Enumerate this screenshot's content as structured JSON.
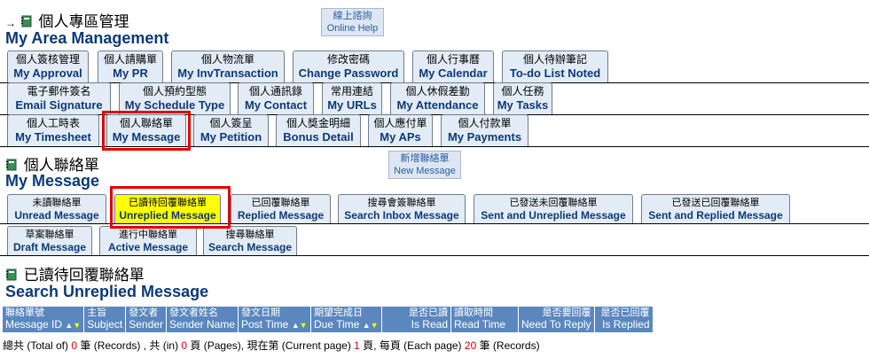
{
  "section1": {
    "arrow": "→",
    "title_zh": "個人專區管理",
    "title_en": "My Area Management",
    "help_zh": "線上諮詢",
    "help_en": "Online Help"
  },
  "area_tabs": [
    [
      {
        "zh": "個人簽核管理",
        "en": "My Approval"
      },
      {
        "zh": "個人請購單",
        "en": "My PR"
      },
      {
        "zh": "個人物流單",
        "en": "My InvTransaction"
      },
      {
        "zh": "修改密碼",
        "en": "Change Password"
      },
      {
        "zh": "個人行事曆",
        "en": "My Calendar"
      },
      {
        "zh": "個人待辦筆記",
        "en": "To-do List Noted"
      }
    ],
    [
      {
        "zh": "電子郵件簽名",
        "en": "Email Signature"
      },
      {
        "zh": "個人預約型態",
        "en": "My Schedule Type"
      },
      {
        "zh": "個人通訊錄",
        "en": "My Contact"
      },
      {
        "zh": "常用連結",
        "en": "My URLs"
      },
      {
        "zh": "個人休假差勤",
        "en": "My Attendance"
      },
      {
        "zh": "個人任務",
        "en": "My Tasks"
      }
    ],
    [
      {
        "zh": "個人工時表",
        "en": "My Timesheet"
      },
      {
        "zh": "個人聯絡單",
        "en": "My Message"
      },
      {
        "zh": "個人簽呈",
        "en": "My Petition"
      },
      {
        "zh": "個人獎金明細",
        "en": "Bonus Detail"
      },
      {
        "zh": "個人應付單",
        "en": "My APs"
      },
      {
        "zh": "個人付款單",
        "en": "My Payments"
      }
    ]
  ],
  "section2": {
    "title_zh": "個人聯絡單",
    "title_en": "My Message",
    "new_zh": "新增聯絡單",
    "new_en": "New Message"
  },
  "msg_tabs": [
    [
      {
        "zh": "未讀聯絡單",
        "en": "Unread Message"
      },
      {
        "zh": "已讀待回覆聯絡單",
        "en": "Unreplied Message"
      },
      {
        "zh": "已回覆聯絡單",
        "en": "Replied Message"
      },
      {
        "zh": "搜尋會簽聯絡單",
        "en": "Search Inbox Message"
      },
      {
        "zh": "已發送未回覆聯絡單",
        "en": "Sent and Unreplied Message"
      },
      {
        "zh": "已發送已回覆聯絡單",
        "en": "Sent and Replied Message"
      }
    ],
    [
      {
        "zh": "草案聯絡單",
        "en": "Draft Message"
      },
      {
        "zh": "進行中聯絡單",
        "en": "Active Message"
      },
      {
        "zh": "搜尋聯絡單",
        "en": "Search Message"
      }
    ]
  ],
  "section3": {
    "title_zh": "已讀待回覆聯絡單",
    "title_en": "Search Unreplied Message"
  },
  "columns": [
    {
      "zh": "聯絡單號",
      "en": "Message ID",
      "sort": true
    },
    {
      "zh": "主旨",
      "en": "Subject"
    },
    {
      "zh": "發文者",
      "en": "Sender"
    },
    {
      "zh": "發文者姓名",
      "en": "Sender Name"
    },
    {
      "zh": "發文日期",
      "en": "Post Time",
      "sort": true
    },
    {
      "zh": "期望完成日",
      "en": "Due Time",
      "sort": true
    },
    {
      "zh": "是否已讀",
      "en": "Is Read",
      "right": true
    },
    {
      "zh": "讀取時間",
      "en": "Read Time"
    },
    {
      "zh": "是否要回覆",
      "en": "Need To Reply",
      "right": true
    },
    {
      "zh": "是否已回覆",
      "en": "Is Replied",
      "right": true
    }
  ],
  "sort_up": "▲",
  "sort_down": "▼",
  "footer": {
    "p1": "總共 (Total of) ",
    "total": "0",
    "p2": " 筆 (Records) , 共 (in) ",
    "pages": "0",
    "p3": " 頁 (Pages), 現在第 (Current page) ",
    "current": "1",
    "p4": " 頁, 每頁 (Each page) ",
    "each": "20",
    "p5": " 筆 (Records)"
  },
  "colors": {
    "accent": "#0b3a78",
    "tab_bg": "#e3ecf6",
    "header_bg": "#5b87bf",
    "highlight": "#ffff00",
    "red": "#e00000"
  }
}
